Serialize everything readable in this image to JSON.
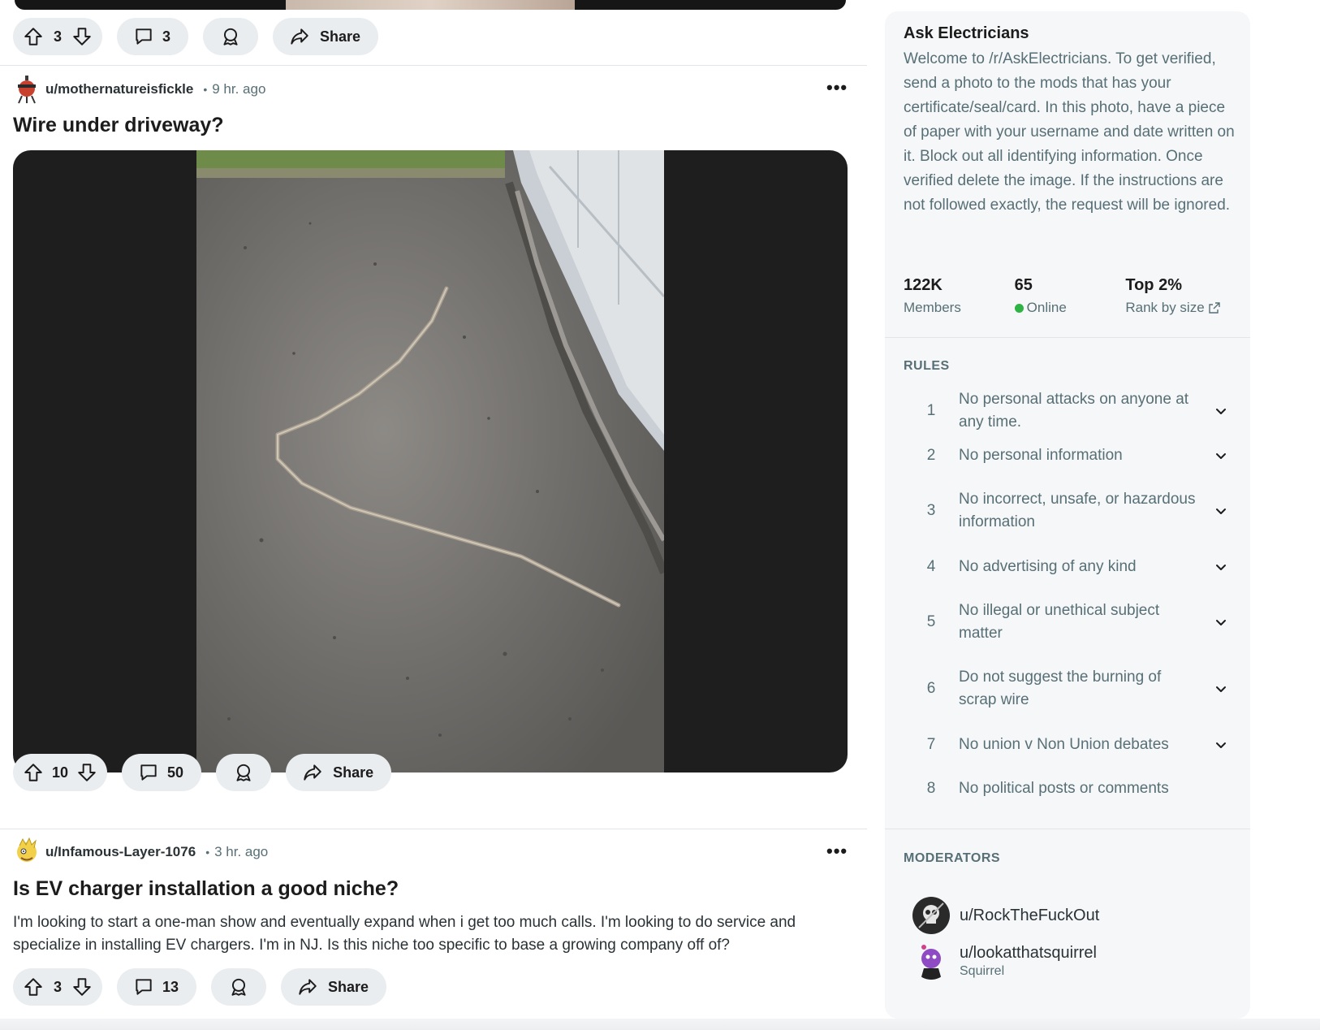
{
  "feed": {
    "posts": [
      {
        "votes": "3",
        "comments": "3",
        "share_label": "Share"
      },
      {
        "author": "u/mothernatureisfickle",
        "time": "9 hr. ago",
        "title": "Wire under driveway?",
        "votes": "10",
        "comments": "50",
        "share_label": "Share"
      },
      {
        "author": "u/Infamous-Layer-1076",
        "time": "3 hr. ago",
        "title": "Is EV charger installation a good niche?",
        "body": "I'm looking to start a one-man show and eventually expand when i get too much calls. I'm looking to do service and specialize in installing EV chargers. I'm in NJ. Is this niche too specific to base a growing company off of?",
        "votes": "3",
        "comments": "13",
        "share_label": "Share"
      }
    ],
    "meta_separator": "•",
    "more_label": "•••"
  },
  "sidebar": {
    "title": "Ask Electricians",
    "description": "Welcome to /r/AskElectricians. To get verified, send a photo to the mods that has your certificate/seal/card. In this photo, have a piece of paper with your username and date written on it. Block out all identifying information. Once verified delete the image. If the instructions are not followed exactly, the request will be ignored.",
    "stats": {
      "members_value": "122K",
      "members_label": "Members",
      "online_value": "65",
      "online_label": "Online",
      "rank_value": "Top 2%",
      "rank_label": "Rank by size"
    },
    "rules_heading": "RULES",
    "rules": [
      {
        "num": "1",
        "text": "No personal attacks on anyone at any time."
      },
      {
        "num": "2",
        "text": "No personal information"
      },
      {
        "num": "3",
        "text": "No incorrect, unsafe, or hazardous information"
      },
      {
        "num": "4",
        "text": "No advertising of any kind"
      },
      {
        "num": "5",
        "text": "No illegal or unethical subject matter"
      },
      {
        "num": "6",
        "text": "Do not suggest the burning of scrap wire"
      },
      {
        "num": "7",
        "text": "No union v Non Union debates"
      },
      {
        "num": "8",
        "text": "No political posts or comments"
      }
    ],
    "moderators_heading": "MODERATORS",
    "moderators": [
      {
        "name": "u/RockTheFuckOut"
      },
      {
        "name": "u/lookatthatsquirrel",
        "flair": "Squirrel"
      }
    ]
  },
  "colors": {
    "pill_bg": "#eaedef",
    "sidebar_bg": "#f6f7f8",
    "muted_text": "#576f76",
    "online_green": "#2fb344"
  }
}
